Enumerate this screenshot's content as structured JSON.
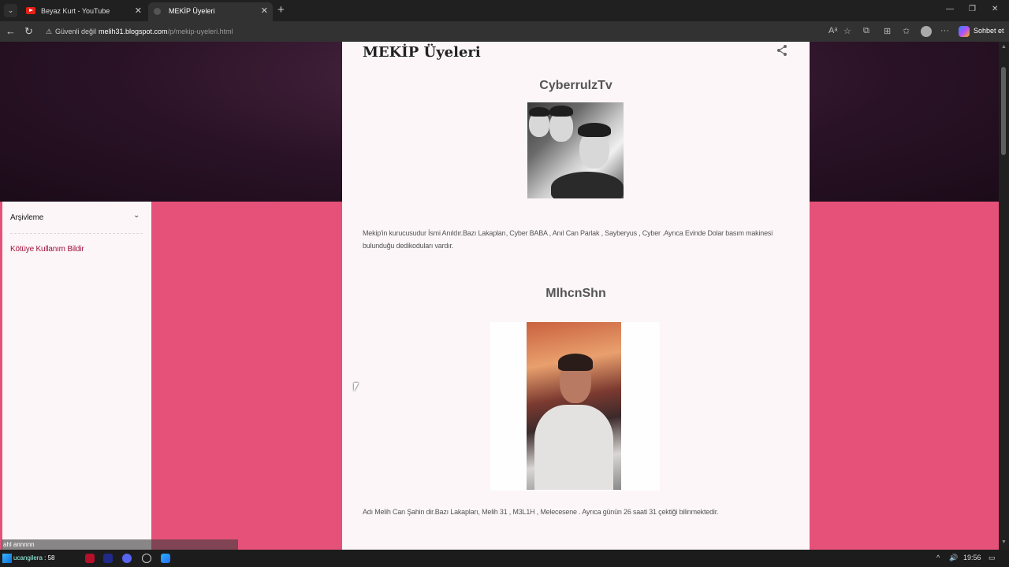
{
  "browser": {
    "tabs": [
      {
        "label": "Beyaz Kurt - YouTube",
        "active": false
      },
      {
        "label": "MEKİP Üyeleri",
        "active": true
      }
    ],
    "security_label": "Güvenli değil",
    "url_host": "melih31.blogspot.com",
    "url_path": "/p/mekip-uyeleri.html",
    "chat_label": "Sohbet et",
    "icons": {
      "warning": "⚠",
      "back": "←",
      "refresh": "↻",
      "close_tab": "✕",
      "new_tab": "+",
      "minimize": "—",
      "maximize": "❐",
      "close_window": "✕",
      "tab_menu": "⌄",
      "read_aloud": "Aᵃ",
      "favorite": "☆",
      "extensions": "⧉",
      "collections": "⊞",
      "favorites": "✩",
      "more": "···"
    }
  },
  "sidebar": {
    "archive_label": "Arşivleme",
    "chevron": "⌄",
    "report_label": "Kötüye Kullanım Bildir"
  },
  "post": {
    "title": "MEKİP Üyeleri",
    "members": [
      {
        "name": "CyberrulzTv",
        "description": "Mekip'in kurucusudur İsmi Anıldır.Bazı Lakapları, Cyber BABA , Anıl Can Parlak , Sayberyus , Cyber .Ayrıca Evinde Dolar basım makinesi bulunduğu dedikoduları vardır."
      },
      {
        "name": "MlhcnShn",
        "description": "Adı Melih Can Şahin dir.Bazı Lakapları, Melih 31 , M3L1H , Melecesene . Ayrıca günün 26 saati 31 çektiği bilinmektedir."
      }
    ]
  },
  "scrollbar": {
    "up": "▲",
    "down": "▼"
  },
  "taskbar": {
    "overlay_prefix": "",
    "overlay_highlight": "",
    "overlay_suffix": "ahl annnnn",
    "search_text": "ucangilera",
    "search_suffix": ": 58",
    "clock": "19:56",
    "tray_chevron": "^",
    "tray_sound": "🔊",
    "notifications": "▭"
  }
}
